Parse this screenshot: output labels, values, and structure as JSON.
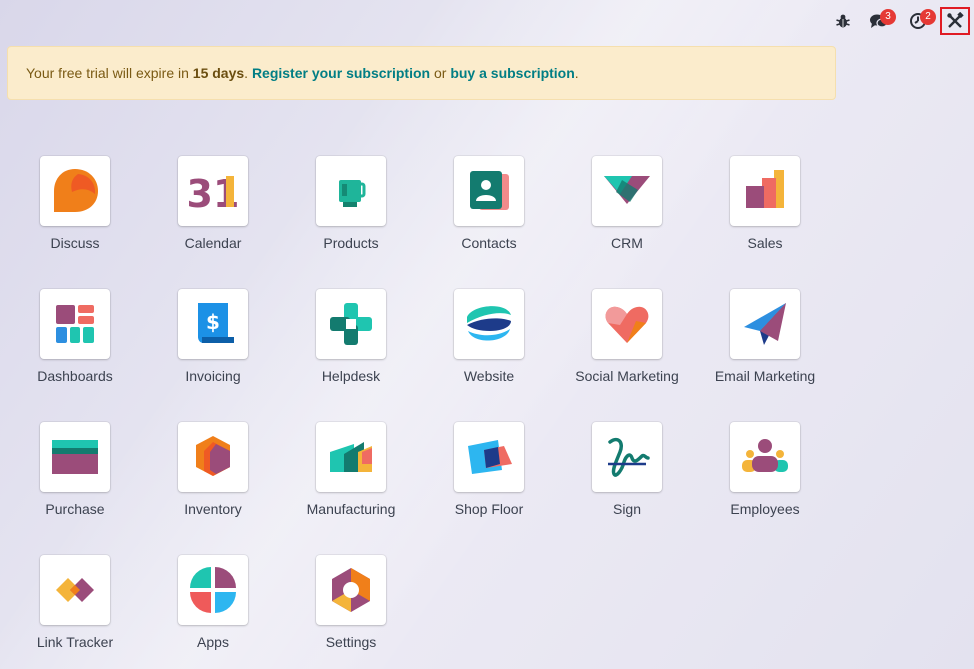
{
  "banner": {
    "prefix": "Your free trial will expire in ",
    "days": "15 days",
    "dot1": ". ",
    "register_link": "Register your subscription",
    "or": " or ",
    "buy_link": "buy a subscription",
    "dot2": "."
  },
  "systray": {
    "debug_icon": "bug-icon",
    "messages_count": "3",
    "activities_count": "2",
    "tools_icon": "tools-icon"
  },
  "apps": [
    {
      "label": "Discuss",
      "icon": "discuss-icon"
    },
    {
      "label": "Calendar",
      "icon": "calendar-icon",
      "icon_text": "31"
    },
    {
      "label": "Products",
      "icon": "products-icon"
    },
    {
      "label": "Contacts",
      "icon": "contacts-icon"
    },
    {
      "label": "CRM",
      "icon": "crm-icon"
    },
    {
      "label": "Sales",
      "icon": "sales-icon"
    },
    {
      "label": "Dashboards",
      "icon": "dashboards-icon"
    },
    {
      "label": "Invoicing",
      "icon": "invoicing-icon",
      "icon_text": "$"
    },
    {
      "label": "Helpdesk",
      "icon": "helpdesk-icon"
    },
    {
      "label": "Website",
      "icon": "website-icon"
    },
    {
      "label": "Social Marketing",
      "icon": "social-marketing-icon"
    },
    {
      "label": "Email Marketing",
      "icon": "email-marketing-icon"
    },
    {
      "label": "Purchase",
      "icon": "purchase-icon"
    },
    {
      "label": "Inventory",
      "icon": "inventory-icon"
    },
    {
      "label": "Manufacturing",
      "icon": "manufacturing-icon"
    },
    {
      "label": "Shop Floor",
      "icon": "shop-floor-icon"
    },
    {
      "label": "Sign",
      "icon": "sign-icon"
    },
    {
      "label": "Employees",
      "icon": "employees-icon"
    },
    {
      "label": "Link Tracker",
      "icon": "link-tracker-icon"
    },
    {
      "label": "Apps",
      "icon": "apps-icon"
    },
    {
      "label": "Settings",
      "icon": "settings-icon"
    }
  ]
}
